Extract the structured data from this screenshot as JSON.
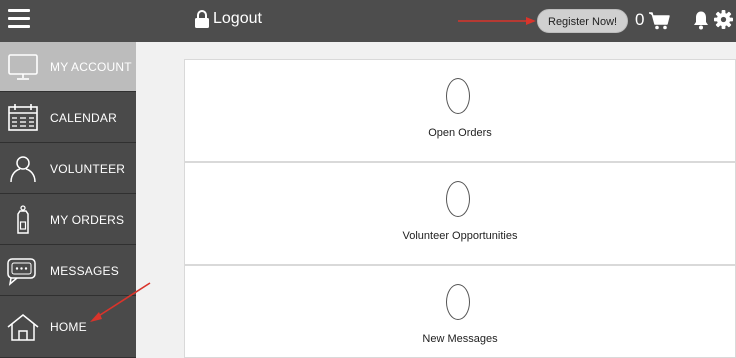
{
  "topbar": {
    "logout_label": "Logout",
    "register_label": "Register Now!",
    "cart_count": "0"
  },
  "sidebar": {
    "items": [
      {
        "label": "MY ACCOUNT",
        "icon": "monitor-icon",
        "active": true
      },
      {
        "label": "CALENDAR",
        "icon": "calendar-icon",
        "active": false
      },
      {
        "label": "VOLUNTEER",
        "icon": "person-icon",
        "active": false
      },
      {
        "label": "MY ORDERS",
        "icon": "tag-icon",
        "active": false
      },
      {
        "label": "MESSAGES",
        "icon": "chat-icon",
        "active": false
      },
      {
        "label": "HOME",
        "icon": "house-icon",
        "active": false
      }
    ]
  },
  "cards": [
    {
      "count": "0",
      "label": "Open Orders"
    },
    {
      "count": "0",
      "label": "Volunteer Opportunities"
    },
    {
      "count": "0",
      "label": "New Messages"
    }
  ],
  "colors": {
    "topbar": "#4d4d4d",
    "sidebar": "#4a4a4a",
    "sidebar_active": "#bcbcbc",
    "annotation_arrow": "#d9342b"
  }
}
